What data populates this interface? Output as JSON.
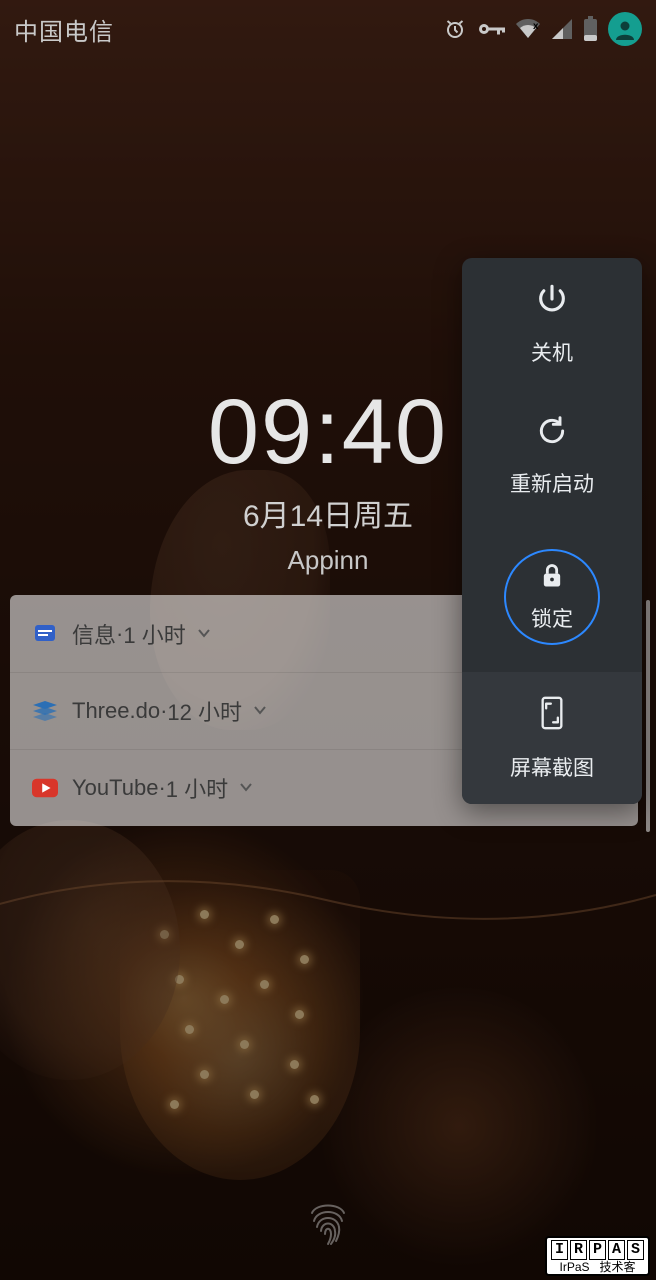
{
  "status": {
    "carrier": "中国电信",
    "icons": {
      "alarm": "alarm-icon",
      "vpn": "vpn-key-icon",
      "wifi": "wifi-no-internet-icon",
      "signal": "signal-icon",
      "battery": "battery-low-icon",
      "avatar": "avatar-icon"
    }
  },
  "clock": {
    "time": "09:40",
    "date": "6月14日周五",
    "owner": "Appinn"
  },
  "notifications": [
    {
      "app": "信息",
      "age": "1 小时",
      "icon": "message-icon",
      "color": "#3060c8"
    },
    {
      "app": "Three.do",
      "age": "12 小时",
      "icon": "layers-icon",
      "color": "#2b6fb5"
    },
    {
      "app": "YouTube",
      "age": "1 小时",
      "icon": "youtube-icon",
      "color": "#d8362a"
    }
  ],
  "power_menu": {
    "items": [
      {
        "id": "power-off",
        "label": "关机",
        "icon": "power-icon"
      },
      {
        "id": "restart",
        "label": "重新启动",
        "icon": "restart-icon"
      },
      {
        "id": "lock",
        "label": "锁定",
        "icon": "lock-icon",
        "highlighted": true
      },
      {
        "id": "screenshot",
        "label": "屏幕截图",
        "icon": "screenshot-icon"
      }
    ]
  },
  "watermark": {
    "brand_chars": [
      "I",
      "R",
      "P",
      "A",
      "S"
    ],
    "line2_left": "IrPaS",
    "line2_right": "技术客"
  },
  "icons": {
    "fingerprint": "fingerprint-icon"
  },
  "separator": " · "
}
